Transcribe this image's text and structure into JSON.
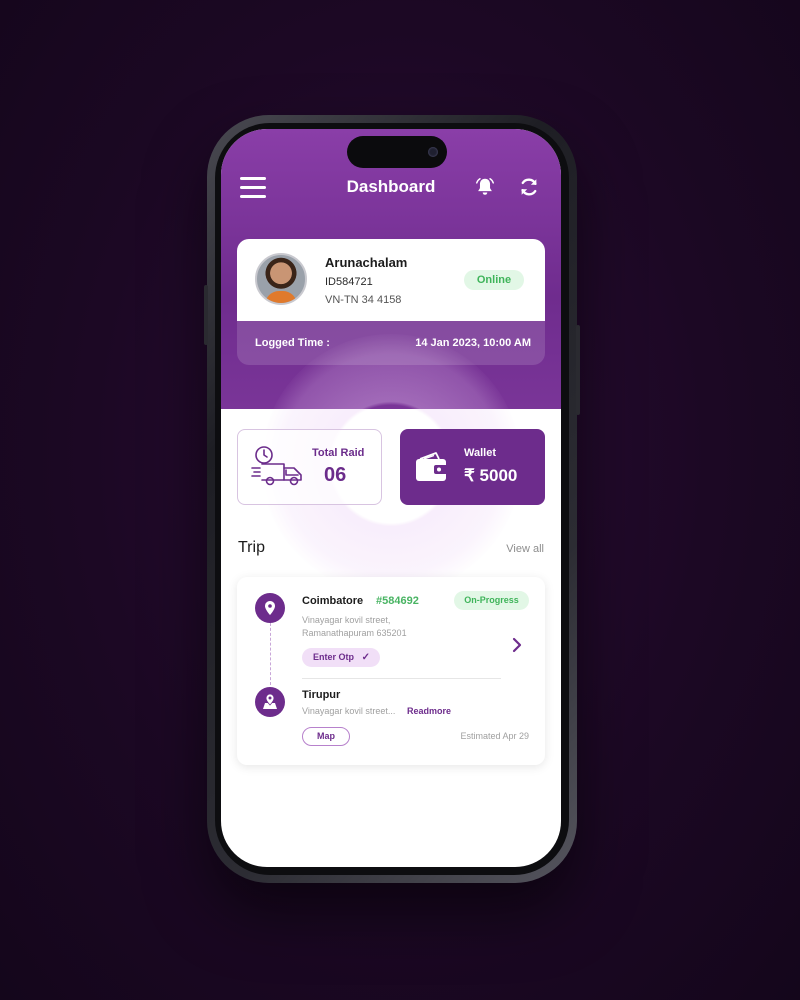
{
  "header": {
    "title": "Dashboard"
  },
  "profile": {
    "name": "Arunachalam",
    "id": "ID584721",
    "vehicle": "VN-TN 34 4158",
    "status": "Online",
    "logged_label": "Logged Time :",
    "logged_value": "14 Jan 2023, 10:00 AM"
  },
  "stats": {
    "raid_label": "Total Raid",
    "raid_value": "06",
    "wallet_label": "Wallet",
    "wallet_value": "₹ 5000"
  },
  "trip_section": {
    "title": "Trip",
    "view_all": "View all"
  },
  "trip": {
    "from_city": "Coimbatore",
    "trip_id": "#584692",
    "status": "On-Progress",
    "from_address_line1": "Vinayagar kovil street,",
    "from_address_line2": "Ramanathapuram 635201",
    "otp_label": "Enter Otp",
    "to_city": "Tirupur",
    "to_address": "Vinayagar kovil street...",
    "readmore": "Readmore",
    "map_label": "Map",
    "eta": "Estimated Apr 29"
  },
  "icons": [
    "menu-icon",
    "bell-icon",
    "refresh-icon",
    "truck-icon",
    "wallet-icon",
    "location-pin-icon",
    "map-pin-icon",
    "check-icon",
    "chevron-right-icon"
  ],
  "colors": {
    "primary": "#6d2c8c",
    "accent_green": "#3fb45a",
    "hero_top": "#8a3ea8"
  }
}
